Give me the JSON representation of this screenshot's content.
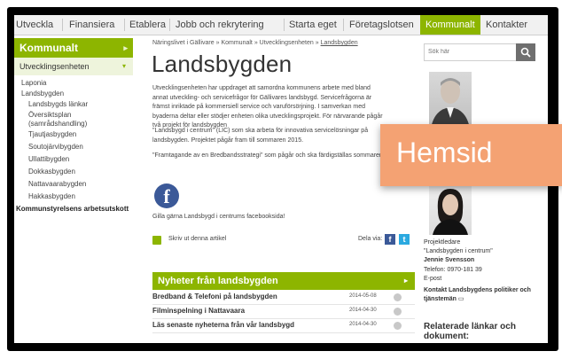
{
  "nav": {
    "items": [
      "Utveckla",
      "Finansiera",
      "Etablera",
      "Jobb och rekrytering",
      "Starta eget",
      "Företagslotsen",
      "Kommunalt",
      "Kontakter"
    ],
    "active": "Kommunalt"
  },
  "sidebar": {
    "heading": "Kommunalt",
    "section": "Utvecklingsenheten",
    "items": [
      "Laponia",
      "Landsbygden",
      "Landsbygds länkar",
      "Översiktsplan (samrådshandling)",
      "Tjautjasbygden",
      "Soutojärvibygden",
      "Ullattibygden",
      "Dokkasbygden",
      "Nattavaarabygden",
      "Hakkasbygden"
    ],
    "bottom": "Kommunstyrelsens arbetsutskott"
  },
  "breadcrumb": {
    "parts": [
      "Näringslivet i Gällivare",
      "Kommunalt",
      "Utvecklingsenheten",
      "Landsbygden"
    ],
    "separator": "»"
  },
  "main": {
    "title": "Landsbygden",
    "paragraphs": [
      "Utvecklingsenheten har uppdraget att samordna kommunens arbete med bland annat utveckling- och servicefrågor för Gällivares landsbygd. Servicefrågorna är främst inriktade på kommersiell service och varuförsörjning. I samverkan med byaderna deltar eller stödjer enheten olika utvecklingsprojekt. För närvarande pågår två projekt för landsbygden",
      "\"Landsbygd i centrum\" (LIC) som ska arbeta för innovativa servicelösningar på landsbygden. Projektet pågår fram till sommaren 2015.",
      "\"Framtagande av en Bredbandsstrategi\" som pågår och ska färdigställas sommaren"
    ],
    "facebook_text": "Gilla gärna Landsbygd i centrums facebooksida!",
    "print_label": "Skriv ut denna artikel",
    "share_label": "Dela via:"
  },
  "news": {
    "heading": "Nyheter från landsbygden",
    "items": [
      {
        "title": "Bredband & Telefoni på landsbygden",
        "date": "2014-05-08"
      },
      {
        "title": "Filminspelning i Nattavaara",
        "date": "2014-04-30"
      },
      {
        "title": "Läs senaste nyheterna från vår landsbygd",
        "date": "2014-04-30"
      }
    ]
  },
  "right": {
    "search_placeholder": "Sök här",
    "contact_role": "Projektledare",
    "contact_project": "\"Landsbygden i centrum\"",
    "contact_name": "Jennie Svensson",
    "contact_phone": "Telefon: 0970-181 39",
    "contact_email": "E-post",
    "contact_link_line1": "Kontakt Landsbygdens politiker och",
    "contact_link_line2": "tjänstemän",
    "related_line1": "Relaterade länkar och",
    "related_line2": "dokument:"
  },
  "overlay": {
    "text": "Hemsid"
  },
  "colors": {
    "accent": "#8db500",
    "overlay": "#f4a273",
    "frame": "#000000"
  }
}
